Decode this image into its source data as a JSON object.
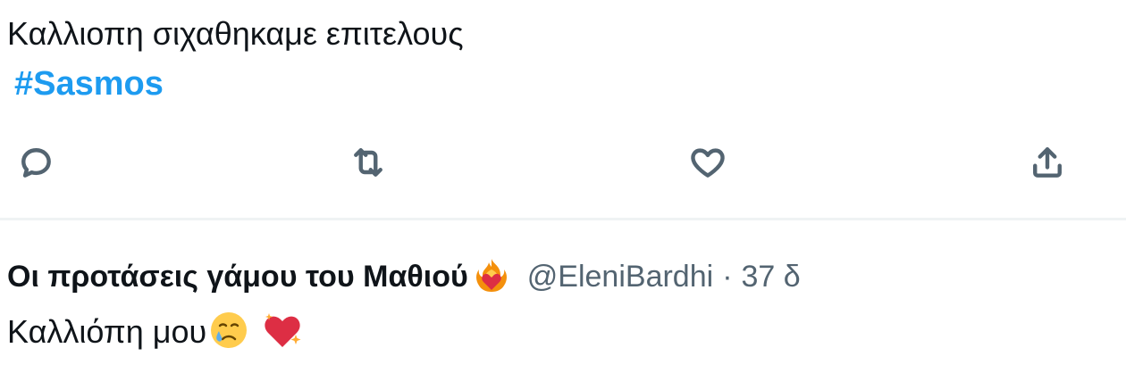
{
  "tweet": {
    "text": "Καλλιοπη σιχαθηκαμε επιτελους",
    "hashtag": "#Sasmos"
  },
  "actions": {
    "reply_icon": "reply-icon",
    "retweet_icon": "retweet-icon",
    "like_icon": "heart-icon",
    "share_icon": "share-icon"
  },
  "reply": {
    "display_name": "Οι προτάσεις γάμου του Μαθιού",
    "name_emoji": "heart-on-fire-emoji",
    "handle": "@EleniBardhi",
    "separator": "·",
    "time": "37 δ",
    "text": "Καλλιόπη μου",
    "text_emojis": [
      "crying-face-emoji",
      "sparkling-heart-emoji"
    ]
  },
  "colors": {
    "link": "#1d9bf0",
    "icon": "#536471",
    "text": "#0f1419",
    "divider": "#eff3f4"
  }
}
